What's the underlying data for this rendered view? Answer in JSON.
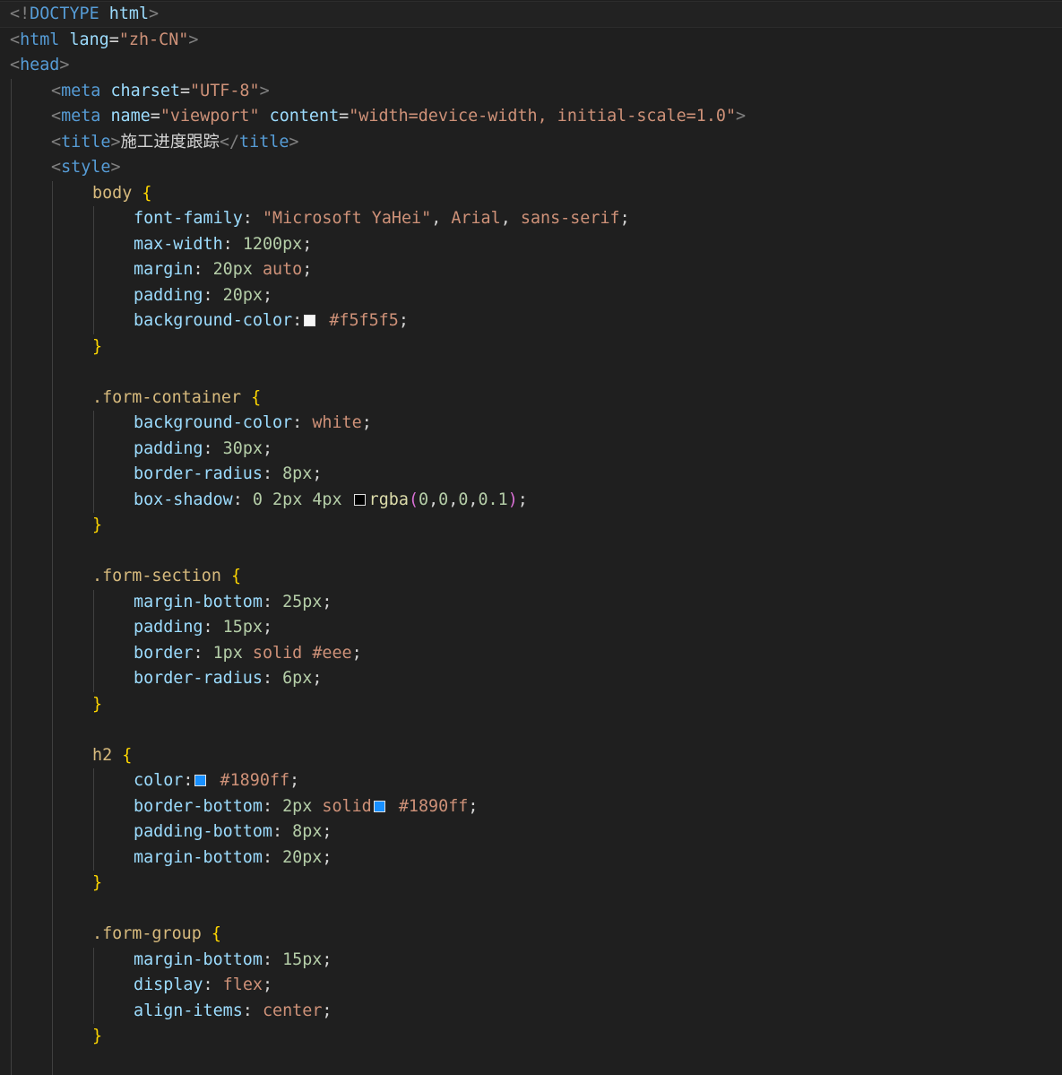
{
  "colors": {
    "background": "#1f1f1f",
    "indent_guide": "#404040",
    "punctuation": "#808080",
    "tag": "#569cd6",
    "attribute": "#9cdcfe",
    "string": "#ce9178",
    "text": "#d4d4d4",
    "selector": "#d7ba7d",
    "property": "#9cdcfe",
    "number": "#b5cea8",
    "value": "#ce9178",
    "brace": "#ffd700",
    "paren": "#da70d6",
    "function": "#dcdcaa"
  },
  "code_lines": [
    {
      "indent": 0,
      "active": true,
      "tokens": [
        [
          "punc",
          "<!"
        ],
        [
          "tag",
          "DOCTYPE"
        ],
        [
          "text",
          " "
        ],
        [
          "attr",
          "html"
        ],
        [
          "punc",
          ">"
        ]
      ]
    },
    {
      "indent": 0,
      "tokens": [
        [
          "punc",
          "<"
        ],
        [
          "tag",
          "html"
        ],
        [
          "text",
          " "
        ],
        [
          "attr",
          "lang"
        ],
        [
          "text",
          "="
        ],
        [
          "str",
          "\"zh-CN\""
        ],
        [
          "punc",
          ">"
        ]
      ]
    },
    {
      "indent": 0,
      "tokens": [
        [
          "punc",
          "<"
        ],
        [
          "tag",
          "head"
        ],
        [
          "punc",
          ">"
        ]
      ]
    },
    {
      "indent": 1,
      "tokens": [
        [
          "punc",
          "<"
        ],
        [
          "tag",
          "meta"
        ],
        [
          "text",
          " "
        ],
        [
          "attr",
          "charset"
        ],
        [
          "text",
          "="
        ],
        [
          "str",
          "\"UTF-8\""
        ],
        [
          "punc",
          ">"
        ]
      ]
    },
    {
      "indent": 1,
      "tokens": [
        [
          "punc",
          "<"
        ],
        [
          "tag",
          "meta"
        ],
        [
          "text",
          " "
        ],
        [
          "attr",
          "name"
        ],
        [
          "text",
          "="
        ],
        [
          "str",
          "\"viewport\""
        ],
        [
          "text",
          " "
        ],
        [
          "attr",
          "content"
        ],
        [
          "text",
          "="
        ],
        [
          "str",
          "\"width=device-width, initial-scale=1.0\""
        ],
        [
          "punc",
          ">"
        ]
      ]
    },
    {
      "indent": 1,
      "tokens": [
        [
          "punc",
          "<"
        ],
        [
          "tag",
          "title"
        ],
        [
          "punc",
          ">"
        ],
        [
          "text",
          "施工进度跟踪"
        ],
        [
          "punc",
          "</"
        ],
        [
          "tag",
          "title"
        ],
        [
          "punc",
          ">"
        ]
      ]
    },
    {
      "indent": 1,
      "tokens": [
        [
          "punc",
          "<"
        ],
        [
          "tag",
          "style"
        ],
        [
          "punc",
          ">"
        ]
      ]
    },
    {
      "indent": 2,
      "tokens": [
        [
          "sel",
          "body"
        ],
        [
          "text",
          " "
        ],
        [
          "brace",
          "{"
        ]
      ]
    },
    {
      "indent": 3,
      "tokens": [
        [
          "prop",
          "font-family"
        ],
        [
          "text",
          ": "
        ],
        [
          "str",
          "\"Microsoft YaHei\""
        ],
        [
          "text",
          ", "
        ],
        [
          "val",
          "Arial"
        ],
        [
          "text",
          ", "
        ],
        [
          "val",
          "sans-serif"
        ],
        [
          "text",
          ";"
        ]
      ]
    },
    {
      "indent": 3,
      "tokens": [
        [
          "prop",
          "max-width"
        ],
        [
          "text",
          ": "
        ],
        [
          "num",
          "1200px"
        ],
        [
          "text",
          ";"
        ]
      ]
    },
    {
      "indent": 3,
      "tokens": [
        [
          "prop",
          "margin"
        ],
        [
          "text",
          ": "
        ],
        [
          "num",
          "20px"
        ],
        [
          "text",
          " "
        ],
        [
          "val",
          "auto"
        ],
        [
          "text",
          ";"
        ]
      ]
    },
    {
      "indent": 3,
      "tokens": [
        [
          "prop",
          "padding"
        ],
        [
          "text",
          ": "
        ],
        [
          "num",
          "20px"
        ],
        [
          "text",
          ";"
        ]
      ]
    },
    {
      "indent": 3,
      "tokens": [
        [
          "prop",
          "background-color"
        ],
        [
          "text",
          ":"
        ],
        [
          "swatch",
          "#f5f5f5"
        ],
        [
          "text",
          " "
        ],
        [
          "val",
          "#f5f5f5"
        ],
        [
          "text",
          ";"
        ]
      ]
    },
    {
      "indent": 2,
      "tokens": [
        [
          "brace",
          "}"
        ]
      ]
    },
    {
      "indent": 0,
      "tokens": []
    },
    {
      "indent": 2,
      "tokens": [
        [
          "sel",
          ".form-container"
        ],
        [
          "text",
          " "
        ],
        [
          "brace",
          "{"
        ]
      ]
    },
    {
      "indent": 3,
      "tokens": [
        [
          "prop",
          "background-color"
        ],
        [
          "text",
          ": "
        ],
        [
          "val",
          "white"
        ],
        [
          "text",
          ";"
        ]
      ]
    },
    {
      "indent": 3,
      "tokens": [
        [
          "prop",
          "padding"
        ],
        [
          "text",
          ": "
        ],
        [
          "num",
          "30px"
        ],
        [
          "text",
          ";"
        ]
      ]
    },
    {
      "indent": 3,
      "tokens": [
        [
          "prop",
          "border-radius"
        ],
        [
          "text",
          ": "
        ],
        [
          "num",
          "8px"
        ],
        [
          "text",
          ";"
        ]
      ]
    },
    {
      "indent": 3,
      "tokens": [
        [
          "prop",
          "box-shadow"
        ],
        [
          "text",
          ": "
        ],
        [
          "num",
          "0"
        ],
        [
          "text",
          " "
        ],
        [
          "num",
          "2px"
        ],
        [
          "text",
          " "
        ],
        [
          "num",
          "4px"
        ],
        [
          "text",
          " "
        ],
        [
          "swatch",
          "#000000"
        ],
        [
          "fn",
          "rgba"
        ],
        [
          "paren",
          "("
        ],
        [
          "num",
          "0"
        ],
        [
          "text",
          ","
        ],
        [
          "num",
          "0"
        ],
        [
          "text",
          ","
        ],
        [
          "num",
          "0"
        ],
        [
          "text",
          ","
        ],
        [
          "num",
          "0.1"
        ],
        [
          "paren",
          ")"
        ],
        [
          "text",
          ";"
        ]
      ]
    },
    {
      "indent": 2,
      "tokens": [
        [
          "brace",
          "}"
        ]
      ]
    },
    {
      "indent": 0,
      "tokens": []
    },
    {
      "indent": 2,
      "tokens": [
        [
          "sel",
          ".form-section"
        ],
        [
          "text",
          " "
        ],
        [
          "brace",
          "{"
        ]
      ]
    },
    {
      "indent": 3,
      "tokens": [
        [
          "prop",
          "margin-bottom"
        ],
        [
          "text",
          ": "
        ],
        [
          "num",
          "25px"
        ],
        [
          "text",
          ";"
        ]
      ]
    },
    {
      "indent": 3,
      "tokens": [
        [
          "prop",
          "padding"
        ],
        [
          "text",
          ": "
        ],
        [
          "num",
          "15px"
        ],
        [
          "text",
          ";"
        ]
      ]
    },
    {
      "indent": 3,
      "tokens": [
        [
          "prop",
          "border"
        ],
        [
          "text",
          ": "
        ],
        [
          "num",
          "1px"
        ],
        [
          "text",
          " "
        ],
        [
          "val",
          "solid"
        ],
        [
          "text",
          " "
        ],
        [
          "val",
          "#eee"
        ],
        [
          "text",
          ";"
        ]
      ]
    },
    {
      "indent": 3,
      "tokens": [
        [
          "prop",
          "border-radius"
        ],
        [
          "text",
          ": "
        ],
        [
          "num",
          "6px"
        ],
        [
          "text",
          ";"
        ]
      ]
    },
    {
      "indent": 2,
      "tokens": [
        [
          "brace",
          "}"
        ]
      ]
    },
    {
      "indent": 0,
      "tokens": []
    },
    {
      "indent": 2,
      "tokens": [
        [
          "sel",
          "h2"
        ],
        [
          "text",
          " "
        ],
        [
          "brace",
          "{"
        ]
      ]
    },
    {
      "indent": 3,
      "tokens": [
        [
          "prop",
          "color"
        ],
        [
          "text",
          ":"
        ],
        [
          "swatch",
          "#1890ff"
        ],
        [
          "text",
          " "
        ],
        [
          "val",
          "#1890ff"
        ],
        [
          "text",
          ";"
        ]
      ]
    },
    {
      "indent": 3,
      "tokens": [
        [
          "prop",
          "border-bottom"
        ],
        [
          "text",
          ": "
        ],
        [
          "num",
          "2px"
        ],
        [
          "text",
          " "
        ],
        [
          "val",
          "solid"
        ],
        [
          "swatch",
          "#1890ff"
        ],
        [
          "text",
          " "
        ],
        [
          "val",
          "#1890ff"
        ],
        [
          "text",
          ";"
        ]
      ]
    },
    {
      "indent": 3,
      "tokens": [
        [
          "prop",
          "padding-bottom"
        ],
        [
          "text",
          ": "
        ],
        [
          "num",
          "8px"
        ],
        [
          "text",
          ";"
        ]
      ]
    },
    {
      "indent": 3,
      "tokens": [
        [
          "prop",
          "margin-bottom"
        ],
        [
          "text",
          ": "
        ],
        [
          "num",
          "20px"
        ],
        [
          "text",
          ";"
        ]
      ]
    },
    {
      "indent": 2,
      "tokens": [
        [
          "brace",
          "}"
        ]
      ]
    },
    {
      "indent": 0,
      "tokens": []
    },
    {
      "indent": 2,
      "tokens": [
        [
          "sel",
          ".form-group"
        ],
        [
          "text",
          " "
        ],
        [
          "brace",
          "{"
        ]
      ]
    },
    {
      "indent": 3,
      "tokens": [
        [
          "prop",
          "margin-bottom"
        ],
        [
          "text",
          ": "
        ],
        [
          "num",
          "15px"
        ],
        [
          "text",
          ";"
        ]
      ]
    },
    {
      "indent": 3,
      "tokens": [
        [
          "prop",
          "display"
        ],
        [
          "text",
          ": "
        ],
        [
          "val",
          "flex"
        ],
        [
          "text",
          ";"
        ]
      ]
    },
    {
      "indent": 3,
      "tokens": [
        [
          "prop",
          "align-items"
        ],
        [
          "text",
          ": "
        ],
        [
          "val",
          "center"
        ],
        [
          "text",
          ";"
        ]
      ]
    },
    {
      "indent": 2,
      "tokens": [
        [
          "brace",
          "}"
        ]
      ]
    },
    {
      "indent": 0,
      "tokens": []
    }
  ]
}
